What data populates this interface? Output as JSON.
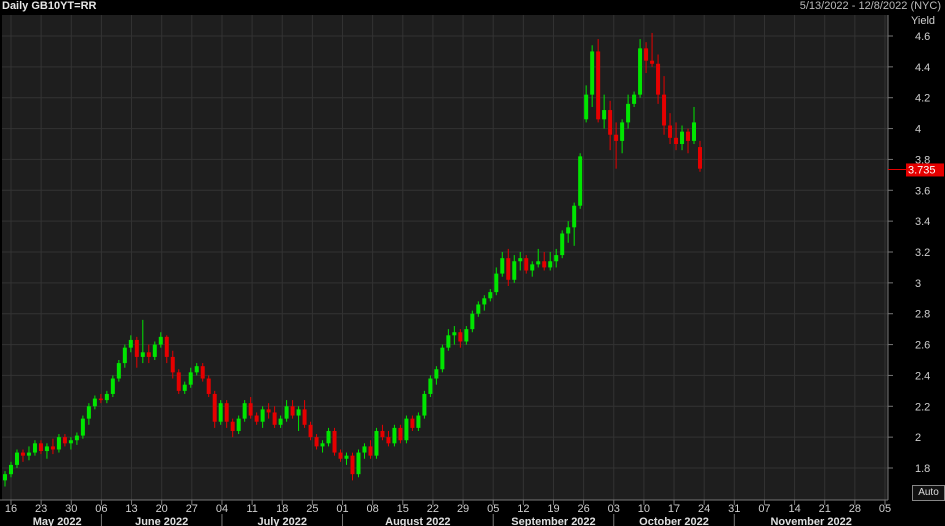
{
  "header": {
    "title": "Daily GB10YT=RR",
    "date_range": "5/13/2022 - 12/8/2022 (NYC)"
  },
  "y_axis_label": "Yield",
  "last_price_label": "3.735",
  "auto_button": "Auto",
  "colors": {
    "up": "#00e600",
    "down": "#e60000",
    "background": "#1e1e1e",
    "grid": "#333333",
    "last_price_bg": "#e60000"
  },
  "chart_data": {
    "type": "candlestick",
    "title": "Daily GB10YT=RR",
    "ylabel": "Yield",
    "ylim": [
      1.64,
      4.7
    ],
    "y_ticks": [
      1.8,
      2,
      2.2,
      2.4,
      2.6,
      2.8,
      3,
      3.2,
      3.4,
      3.6,
      3.8,
      4,
      4.2,
      4.4,
      4.6
    ],
    "x_ticks": [
      "16",
      "23",
      "30",
      "06",
      "13",
      "20",
      "27",
      "04",
      "11",
      "18",
      "25",
      "01",
      "08",
      "15",
      "22",
      "29",
      "05",
      "12",
      "19",
      "26",
      "03",
      "10",
      "17",
      "24",
      "31",
      "07",
      "14",
      "21",
      "28",
      "05"
    ],
    "months": [
      "May 2022",
      "June 2022",
      "July 2022",
      "August 2022",
      "September 2022",
      "October 2022",
      "November 2022"
    ],
    "last_value": 3.735,
    "candles": [
      [
        1.72,
        1.78,
        1.68,
        1.76
      ],
      [
        1.76,
        1.84,
        1.74,
        1.82
      ],
      [
        1.82,
        1.92,
        1.8,
        1.9
      ],
      [
        1.9,
        1.92,
        1.84,
        1.88
      ],
      [
        1.88,
        1.94,
        1.85,
        1.9
      ],
      [
        1.9,
        1.98,
        1.88,
        1.96
      ],
      [
        1.96,
        1.98,
        1.89,
        1.91
      ],
      [
        1.91,
        1.96,
        1.86,
        1.94
      ],
      [
        1.94,
        1.99,
        1.89,
        1.92
      ],
      [
        1.92,
        2.02,
        1.9,
        2.0
      ],
      [
        2.0,
        2.02,
        1.94,
        1.96
      ],
      [
        1.96,
        2.0,
        1.92,
        1.98
      ],
      [
        1.98,
        2.03,
        1.95,
        2.01
      ],
      [
        2.01,
        2.14,
        1.99,
        2.12
      ],
      [
        2.12,
        2.22,
        2.08,
        2.2
      ],
      [
        2.2,
        2.27,
        2.18,
        2.25
      ],
      [
        2.25,
        2.28,
        2.22,
        2.24
      ],
      [
        2.24,
        2.3,
        2.22,
        2.28
      ],
      [
        2.28,
        2.4,
        2.26,
        2.38
      ],
      [
        2.38,
        2.5,
        2.36,
        2.48
      ],
      [
        2.48,
        2.6,
        2.45,
        2.58
      ],
      [
        2.58,
        2.66,
        2.55,
        2.63
      ],
      [
        2.63,
        2.65,
        2.45,
        2.52
      ],
      [
        2.52,
        2.76,
        2.48,
        2.55
      ],
      [
        2.55,
        2.6,
        2.48,
        2.52
      ],
      [
        2.52,
        2.62,
        2.5,
        2.6
      ],
      [
        2.6,
        2.68,
        2.58,
        2.65
      ],
      [
        2.65,
        2.66,
        2.48,
        2.52
      ],
      [
        2.52,
        2.56,
        2.38,
        2.42
      ],
      [
        2.42,
        2.44,
        2.28,
        2.3
      ],
      [
        2.3,
        2.36,
        2.28,
        2.34
      ],
      [
        2.34,
        2.45,
        2.32,
        2.42
      ],
      [
        2.42,
        2.48,
        2.4,
        2.46
      ],
      [
        2.46,
        2.48,
        2.36,
        2.38
      ],
      [
        2.38,
        2.4,
        2.26,
        2.28
      ],
      [
        2.28,
        2.3,
        2.06,
        2.1
      ],
      [
        2.1,
        2.24,
        2.08,
        2.22
      ],
      [
        2.22,
        2.24,
        2.06,
        2.1
      ],
      [
        2.1,
        2.12,
        2.0,
        2.04
      ],
      [
        2.04,
        2.14,
        2.02,
        2.12
      ],
      [
        2.12,
        2.24,
        2.1,
        2.22
      ],
      [
        2.22,
        2.26,
        2.12,
        2.14
      ],
      [
        2.14,
        2.16,
        2.08,
        2.1
      ],
      [
        2.1,
        2.2,
        2.06,
        2.18
      ],
      [
        2.18,
        2.22,
        2.12,
        2.16
      ],
      [
        2.16,
        2.2,
        2.06,
        2.08
      ],
      [
        2.08,
        2.14,
        2.06,
        2.12
      ],
      [
        2.12,
        2.24,
        2.1,
        2.2
      ],
      [
        2.2,
        2.24,
        2.12,
        2.14
      ],
      [
        2.14,
        2.2,
        2.04,
        2.18
      ],
      [
        2.18,
        2.24,
        2.06,
        2.08
      ],
      [
        2.08,
        2.1,
        1.98,
        2.0
      ],
      [
        2.0,
        2.02,
        1.92,
        1.94
      ],
      [
        1.94,
        1.98,
        1.9,
        1.96
      ],
      [
        1.96,
        2.06,
        1.94,
        2.04
      ],
      [
        2.04,
        2.06,
        1.88,
        1.9
      ],
      [
        1.9,
        1.92,
        1.84,
        1.86
      ],
      [
        1.86,
        1.9,
        1.82,
        1.88
      ],
      [
        1.88,
        1.9,
        1.72,
        1.76
      ],
      [
        1.76,
        1.92,
        1.74,
        1.9
      ],
      [
        1.9,
        1.96,
        1.86,
        1.94
      ],
      [
        1.94,
        1.98,
        1.86,
        1.88
      ],
      [
        1.88,
        2.06,
        1.86,
        2.04
      ],
      [
        2.04,
        2.08,
        1.98,
        2.0
      ],
      [
        2.0,
        2.04,
        1.94,
        1.96
      ],
      [
        1.96,
        2.08,
        1.94,
        2.06
      ],
      [
        2.06,
        2.08,
        1.96,
        1.98
      ],
      [
        1.98,
        2.14,
        1.96,
        2.12
      ],
      [
        2.12,
        2.14,
        2.04,
        2.06
      ],
      [
        2.06,
        2.16,
        2.04,
        2.14
      ],
      [
        2.14,
        2.3,
        2.12,
        2.28
      ],
      [
        2.28,
        2.4,
        2.26,
        2.38
      ],
      [
        2.38,
        2.46,
        2.34,
        2.44
      ],
      [
        2.44,
        2.6,
        2.42,
        2.58
      ],
      [
        2.58,
        2.7,
        2.56,
        2.66
      ],
      [
        2.66,
        2.72,
        2.6,
        2.68
      ],
      [
        2.68,
        2.7,
        2.58,
        2.62
      ],
      [
        2.62,
        2.72,
        2.6,
        2.7
      ],
      [
        2.7,
        2.82,
        2.68,
        2.8
      ],
      [
        2.8,
        2.88,
        2.78,
        2.86
      ],
      [
        2.86,
        2.92,
        2.82,
        2.9
      ],
      [
        2.9,
        2.96,
        2.88,
        2.94
      ],
      [
        2.94,
        3.1,
        2.92,
        3.06
      ],
      [
        3.06,
        3.2,
        3.04,
        3.16
      ],
      [
        3.16,
        3.22,
        2.98,
        3.02
      ],
      [
        3.02,
        3.18,
        3.0,
        3.14
      ],
      [
        3.14,
        3.2,
        3.08,
        3.16
      ],
      [
        3.16,
        3.18,
        3.06,
        3.08
      ],
      [
        3.08,
        3.14,
        3.04,
        3.12
      ],
      [
        3.12,
        3.22,
        3.1,
        3.14
      ],
      [
        3.14,
        3.2,
        3.08,
        3.1
      ],
      [
        3.1,
        3.2,
        3.08,
        3.14
      ],
      [
        3.14,
        3.22,
        3.1,
        3.18
      ],
      [
        3.18,
        3.34,
        3.16,
        3.32
      ],
      [
        3.32,
        3.4,
        3.26,
        3.36
      ],
      [
        3.36,
        3.52,
        3.24,
        3.5
      ],
      [
        3.5,
        3.84,
        3.48,
        3.82
      ],
      [
        4.06,
        4.28,
        4.04,
        4.22
      ],
      [
        4.22,
        4.54,
        4.14,
        4.5
      ],
      [
        4.5,
        4.58,
        4.04,
        4.06
      ],
      [
        4.06,
        4.22,
        4.0,
        4.12
      ],
      [
        4.12,
        4.18,
        3.86,
        3.96
      ],
      [
        3.96,
        4.04,
        3.74,
        3.92
      ],
      [
        3.92,
        4.06,
        3.84,
        4.04
      ],
      [
        4.04,
        4.22,
        4.0,
        4.16
      ],
      [
        4.16,
        4.24,
        4.14,
        4.22
      ],
      [
        4.22,
        4.58,
        4.2,
        4.52
      ],
      [
        4.52,
        4.56,
        4.36,
        4.44
      ],
      [
        4.44,
        4.62,
        4.4,
        4.42
      ],
      [
        4.42,
        4.48,
        4.16,
        4.22
      ],
      [
        4.22,
        4.34,
        3.96,
        4.02
      ],
      [
        4.02,
        4.1,
        3.9,
        3.94
      ],
      [
        3.94,
        4.04,
        3.86,
        3.9
      ],
      [
        3.9,
        4.02,
        3.86,
        3.98
      ],
      [
        3.98,
        4.0,
        3.84,
        3.92
      ],
      [
        3.92,
        4.14,
        3.9,
        4.04
      ],
      [
        3.88,
        3.92,
        3.72,
        3.74
      ]
    ]
  }
}
